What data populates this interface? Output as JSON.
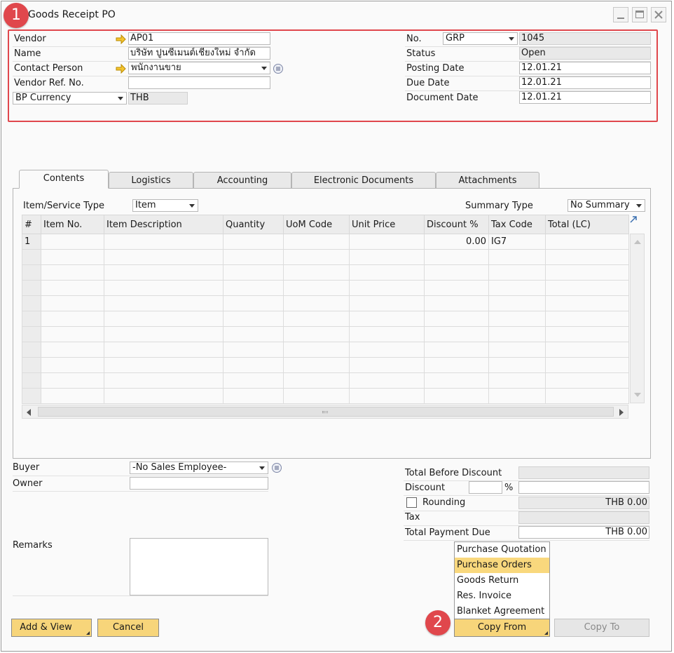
{
  "window": {
    "title": "Goods Receipt PO"
  },
  "callouts": {
    "one": "1",
    "two": "2"
  },
  "header": {
    "vendor_label": "Vendor",
    "vendor_value": "AP01",
    "name_label": "Name",
    "name_value": "บริษัท ปูนซีเมนต์เชียงใหม่ จำกัด",
    "contact_label": "Contact Person",
    "contact_value": "พนักงานขาย",
    "vendor_ref_label": "Vendor Ref. No.",
    "vendor_ref_value": "",
    "currency_select": "BP Currency",
    "currency_value": "THB",
    "no_label": "No.",
    "series_value": "GRP",
    "doc_number": "1045",
    "status_label": "Status",
    "status_value": "Open",
    "posting_label": "Posting Date",
    "posting_value": "12.01.21",
    "due_label": "Due Date",
    "due_value": "12.01.21",
    "docdate_label": "Document Date",
    "docdate_value": "12.01.21"
  },
  "tabs": [
    "Contents",
    "Logistics",
    "Accounting",
    "Electronic Documents",
    "Attachments"
  ],
  "contents": {
    "item_type_label": "Item/Service Type",
    "item_type_value": "Item",
    "summary_label": "Summary Type",
    "summary_value": "No Summary",
    "columns": [
      "#",
      "Item No.",
      "Item Description",
      "Quantity",
      "UoM Code",
      "Unit Price",
      "Discount %",
      "Tax Code",
      "Total (LC)"
    ],
    "rows": [
      [
        "1",
        "",
        "",
        "",
        "",
        "",
        "0.00",
        "IG7",
        ""
      ]
    ]
  },
  "footer": {
    "buyer_label": "Buyer",
    "buyer_value": "-No Sales Employee-",
    "owner_label": "Owner",
    "owner_value": "",
    "remarks_label": "Remarks",
    "remarks_value": "",
    "total_before_label": "Total Before Discount",
    "total_before_value": "",
    "discount_label": "Discount",
    "discount_pct": "",
    "pct_sign": "%",
    "discount_value": "",
    "rounding_label": "Rounding",
    "rounding_value": "THB 0.00",
    "tax_label": "Tax",
    "tax_value": "",
    "total_due_label": "Total Payment Due",
    "total_due_value": "THB 0.00"
  },
  "copy_from_menu": [
    "Purchase Quotation",
    "Purchase Orders",
    "Goods Return",
    "Res. Invoice",
    "Blanket Agreement"
  ],
  "buttons": {
    "add_view": "Add & View",
    "cancel": "Cancel",
    "copy_from": "Copy From",
    "copy_to": "Copy To"
  },
  "colors": {
    "accent_button": "#f7d57a",
    "callout_red": "#e0474c",
    "menu_highlight": "#f9d87d"
  }
}
